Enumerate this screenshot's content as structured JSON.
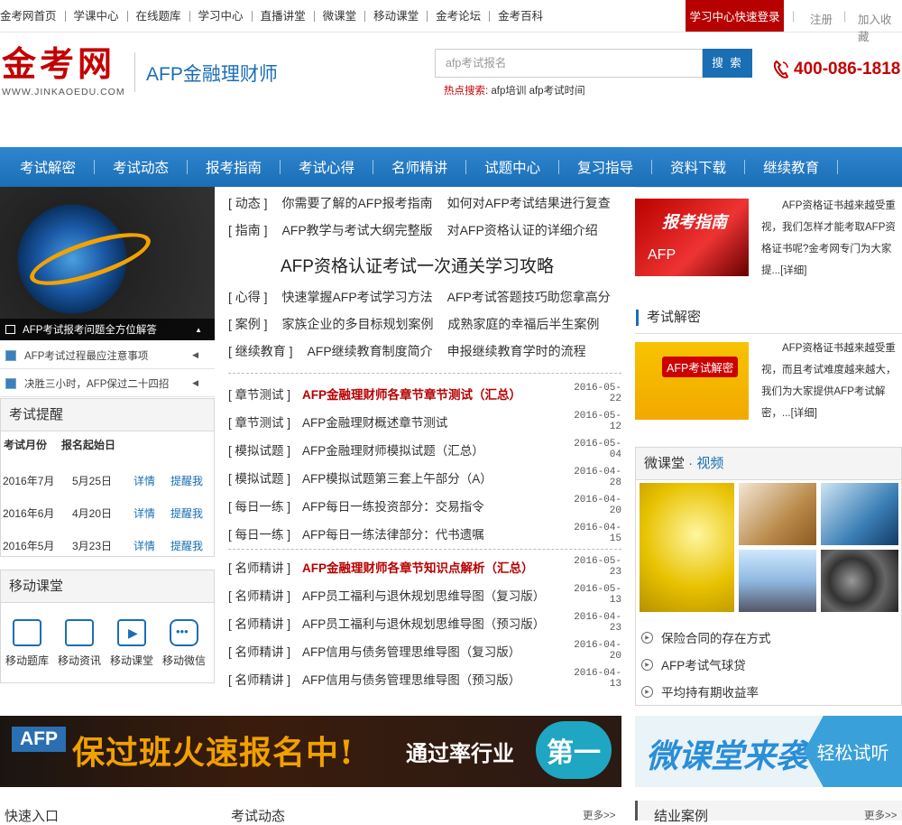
{
  "topbar": {
    "nav": [
      "金考网首页",
      "学课中心",
      "在线题库",
      "学习中心",
      "直播讲堂",
      "微课堂",
      "移动课堂",
      "金考论坛",
      "金考百科"
    ],
    "login_button": "学习中心快速登录",
    "register": "注册",
    "favorite": "加入收藏"
  },
  "header": {
    "logo_cn": "金考网",
    "logo_en": "WWW.JINKAOEDU.COM",
    "subtitle": "AFP金融理财师",
    "search_placeholder": "afp考试报名",
    "search_button": "搜 索",
    "hot_label": "热点搜索:",
    "hot_links": "afp培训 afp考试时间",
    "phone": "400-086-1818"
  },
  "mainnav": [
    "考试解密",
    "考试动态",
    "报考指南",
    "考试心得",
    "名师精讲",
    "试题中心",
    "复习指导",
    "资料下载",
    "继续教育"
  ],
  "left": {
    "banner_caption": "AFP考试报考问题全方位解答",
    "links": [
      "AFP考试过程最应注意事项",
      "决胜三小时，AFP保过二十四招"
    ],
    "remind_title": "考试提醒",
    "remind_headers": [
      "考试月份",
      "报名起始日"
    ],
    "remind_rows": [
      {
        "month": "2016年7月",
        "start": "5月25日",
        "detail": "详情",
        "remind": "提醒我"
      },
      {
        "month": "2016年6月",
        "start": "4月20日",
        "detail": "详情",
        "remind": "提醒我"
      },
      {
        "month": "2016年5月",
        "start": "3月23日",
        "detail": "详情",
        "remind": "提醒我"
      }
    ],
    "mobile_title": "移动课堂",
    "mobile_items": [
      "移动题库",
      "移动资讯",
      "移动课堂",
      "移动微信"
    ]
  },
  "center": {
    "cat_rows_top": [
      {
        "cat": "动态",
        "links": [
          "你需要了解的AFP报考指南",
          "如何对AFP考试结果进行复查"
        ]
      },
      {
        "cat": "指南",
        "links": [
          "AFP教学与考试大纲完整版",
          "对AFP资格认证的详细介绍"
        ]
      }
    ],
    "headline": "AFP资格认证考试一次通关学习攻略",
    "cat_rows_bottom": [
      {
        "cat": "心得",
        "links": [
          "快速掌握AFP考试学习方法",
          "AFP考试答题技巧助您拿高分"
        ]
      },
      {
        "cat": "案例",
        "links": [
          "家族企业的多目标规划案例",
          "成熟家庭的幸福后半生案例"
        ]
      },
      {
        "cat": "继续教育",
        "links": [
          "AFP继续教育制度简介",
          "申报继续教育学时的流程"
        ]
      }
    ],
    "news_group1": [
      {
        "cat": "[ 章节测试 ]",
        "title": "AFP金融理财师各章节章节测试（汇总）",
        "date": "2016-05-22",
        "hot": true
      },
      {
        "cat": "[ 章节测试 ]",
        "title": "AFP金融理财概述章节测试",
        "date": "2016-05-12",
        "hot": false
      },
      {
        "cat": "[ 模拟试题 ]",
        "title": "AFP金融理财师模拟试题（汇总）",
        "date": "2016-05-04",
        "hot": false
      },
      {
        "cat": "[ 模拟试题 ]",
        "title": "AFP模拟试题第三套上午部分（A）",
        "date": "2016-04-28",
        "hot": false
      },
      {
        "cat": "[ 每日一练 ]",
        "title": "AFP每日一练投资部分：交易指令",
        "date": "2016-04-20",
        "hot": false
      },
      {
        "cat": "[ 每日一练 ]",
        "title": "AFP每日一练法律部分：代书遗嘱",
        "date": "2016-04-15",
        "hot": false
      }
    ],
    "news_group2": [
      {
        "cat": "[ 名师精讲 ]",
        "title": "AFP金融理财师各章节知识点解析（汇总）",
        "date": "2016-05-23",
        "hot": true
      },
      {
        "cat": "[ 名师精讲 ]",
        "title": "AFP员工福利与退休规划思维导图（复习版）",
        "date": "2016-05-13",
        "hot": false
      },
      {
        "cat": "[ 名师精讲 ]",
        "title": "AFP员工福利与退休规划思维导图（预习版）",
        "date": "2016-04-23",
        "hot": false
      },
      {
        "cat": "[ 名师精讲 ]",
        "title": "AFP信用与债务管理思维导图（复习版）",
        "date": "2016-04-20",
        "hot": false
      },
      {
        "cat": "[ 名师精讲 ]",
        "title": "AFP信用与债务管理思维导图（预习版）",
        "date": "2016-04-13",
        "hot": false
      }
    ]
  },
  "right": {
    "guide_img_text": "报考指南",
    "guide_img_sub": "AFP",
    "guide_text": "AFP资格证书越来越受重视，我们怎样才能考取AFP资格证书呢?金考网专门为大家提...[详细]",
    "secret_title": "考试解密",
    "secret_img_text": "AFP考试解密",
    "secret_text": "AFP资格证书越来越受重视，而且考试难度越来越大，我们为大家提供AFP考试解密，...[详细]",
    "micro_title_a": "微课堂",
    "micro_dot": " · ",
    "micro_title_b": "视频",
    "micro_links": [
      "保险合同的存在方式",
      "AFP考试气球贷",
      "平均持有期收益率"
    ]
  },
  "banners": {
    "big_tag": "AFP",
    "big_main": "保过班火速报名中!",
    "big_sub": "通过率行业",
    "big_first": "第一",
    "mini_a": "微课堂来袭",
    "mini_b": "轻松试听"
  },
  "bottom": {
    "quick": "快速入口",
    "dynamics": "考试动态",
    "more1": "更多>>",
    "cases": "结业案例",
    "more2": "更多>>"
  }
}
